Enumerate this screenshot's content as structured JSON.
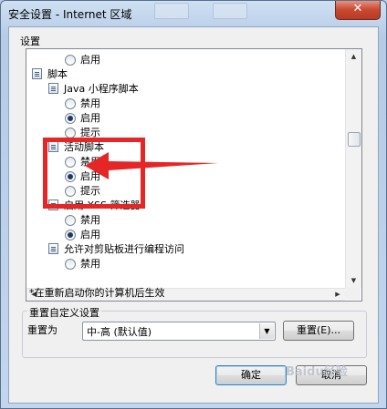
{
  "window": {
    "title": "安全设置 - Internet 区域",
    "close_glyph": "✕"
  },
  "settings_label": "设置",
  "tree": [
    {
      "kind": "radio",
      "label": "启用",
      "selected": false,
      "level": 2
    },
    {
      "kind": "category",
      "label": "脚本",
      "level": 0
    },
    {
      "kind": "category",
      "label": "Java 小程序脚本",
      "level": 1
    },
    {
      "kind": "radio",
      "label": "禁用",
      "selected": false,
      "level": 2
    },
    {
      "kind": "radio",
      "label": "启用",
      "selected": true,
      "level": 2
    },
    {
      "kind": "radio",
      "label": "提示",
      "selected": false,
      "level": 2
    },
    {
      "kind": "category",
      "label": "活动脚本",
      "level": 1
    },
    {
      "kind": "radio",
      "label": "禁用",
      "selected": false,
      "level": 2
    },
    {
      "kind": "radio",
      "label": "启用",
      "selected": true,
      "level": 2
    },
    {
      "kind": "radio",
      "label": "提示",
      "selected": false,
      "level": 2
    },
    {
      "kind": "category",
      "label": "启用 XSS 筛选器",
      "level": 1
    },
    {
      "kind": "radio",
      "label": "禁用",
      "selected": false,
      "level": 2
    },
    {
      "kind": "radio",
      "label": "启用",
      "selected": true,
      "level": 2
    },
    {
      "kind": "category",
      "label": "允许对剪贴板进行编程访问",
      "level": 1
    },
    {
      "kind": "radio",
      "label": "禁用",
      "selected": false,
      "level": 2
    }
  ],
  "note": "*在重新启动你的计算机后生效",
  "reset": {
    "group_title": "重置自定义设置",
    "reset_to_label": "重置为",
    "select_value": "中-高 (默认值)",
    "reset_button": "重置(E)..."
  },
  "buttons": {
    "ok": "确定",
    "cancel": "取消"
  },
  "watermark": "Baidu经验",
  "annotation_color": "#e62626"
}
